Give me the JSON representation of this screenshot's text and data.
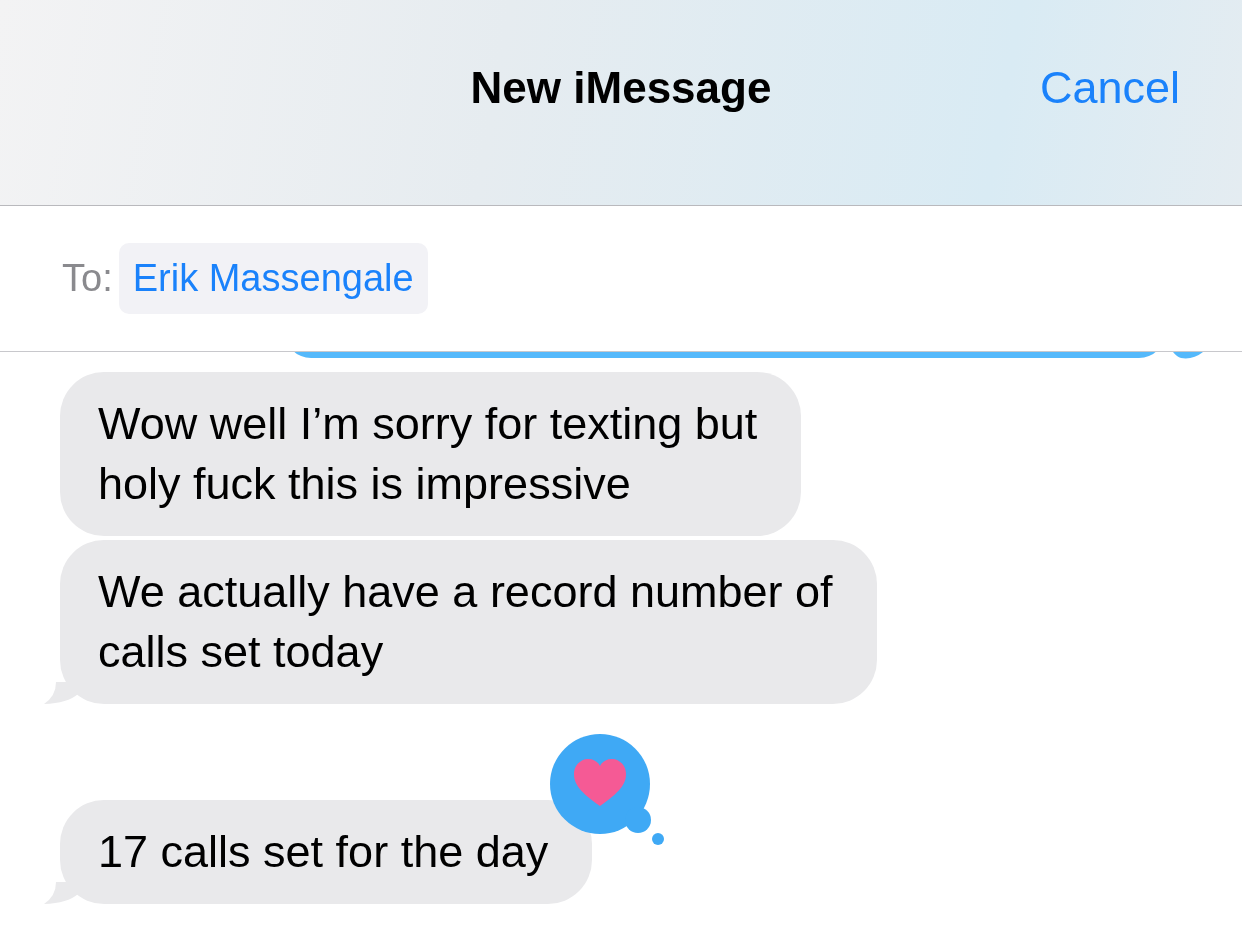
{
  "header": {
    "title": "New iMessage",
    "cancel": "Cancel"
  },
  "recipient": {
    "label": "To:",
    "name": "Erik Massengale"
  },
  "messages": [
    {
      "kind": "sent",
      "tail": true
    },
    {
      "kind": "received",
      "text": "Wow well I’m sorry for texting but\nholy fuck this is impressive",
      "tail": false
    },
    {
      "kind": "received",
      "text": "We actually have a record number of\ncalls set today",
      "tail": true
    },
    {
      "kind": "received",
      "text": "17 calls set for the day",
      "tail": true,
      "heart_reaction": true
    }
  ]
}
